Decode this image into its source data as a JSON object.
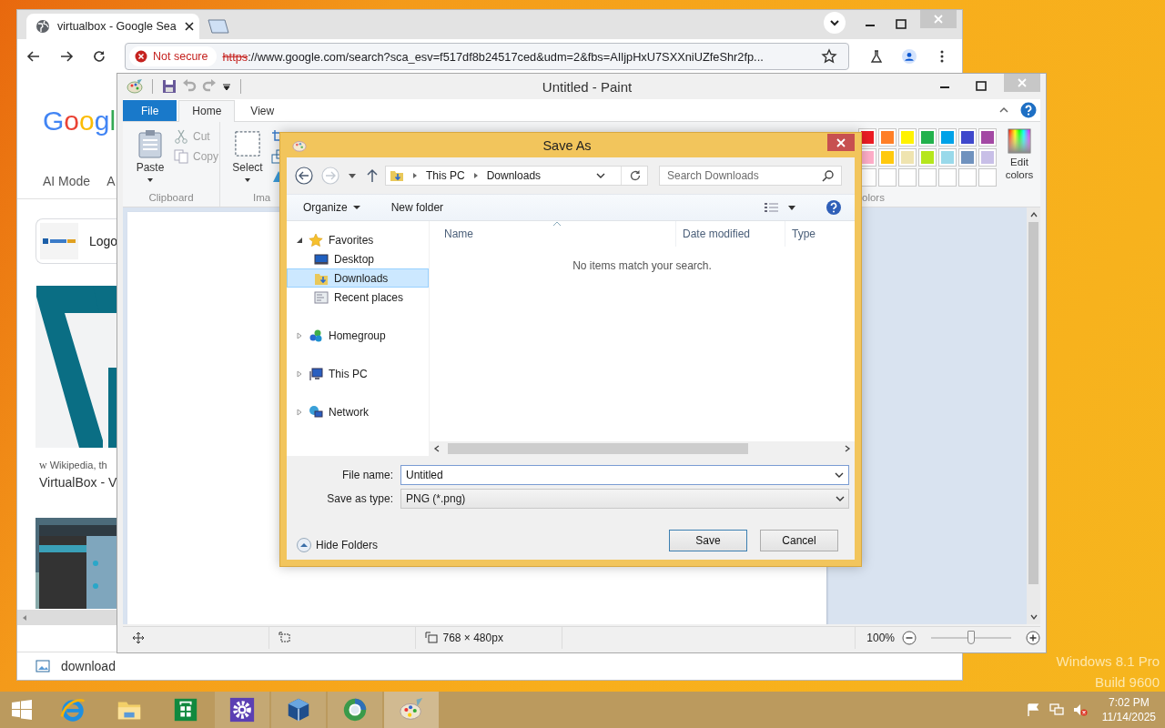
{
  "browser": {
    "tab": {
      "title": "virtualbox - Google Sea",
      "selected": true
    },
    "security": "Not secure",
    "url_scheme": "https",
    "url_rest": "://www.google.com/search?sca_esv=f517df8b24517ced&udm=2&fbs=AIljpHxU7SXXniUZfeShr2fp...",
    "logo": "Googl",
    "nav": [
      "AI Mode",
      "A"
    ],
    "card_label": "Logo",
    "source_mark": "w",
    "source": "Wikipedia, th",
    "result_title": "VirtualBox - V",
    "download": "download"
  },
  "paint": {
    "title": "Untitled - Paint",
    "tabs": [
      {
        "label": "File",
        "kind": "file",
        "selected": false
      },
      {
        "label": "Home",
        "kind": "tab",
        "selected": true
      },
      {
        "label": "View",
        "kind": "tab",
        "selected": false
      }
    ],
    "paste": "Paste",
    "cut": {
      "label": "Cut",
      "disabled": true
    },
    "copy": {
      "label": "Copy",
      "disabled": true
    },
    "clipboard_group": "Clipboard",
    "select": "Select",
    "image_group": "Ima",
    "palette": [
      {
        "color": "#ed1c24"
      },
      {
        "color": "#ff7f27"
      },
      {
        "color": "#fff200"
      },
      {
        "color": "#22b14c"
      },
      {
        "color": "#00a2e8"
      },
      {
        "color": "#3f48cc"
      },
      {
        "color": "#a349a4"
      },
      {
        "color": "#ffaec9"
      },
      {
        "color": "#ffc90e"
      },
      {
        "color": "#efe4b0"
      },
      {
        "color": "#b5e61d"
      },
      {
        "color": "#99d9ea"
      },
      {
        "color": "#7092be"
      },
      {
        "color": "#c8bfe7"
      }
    ],
    "edit_colors": "Edit colors",
    "colors_group": "olors",
    "status": {
      "size": "768 × 480px",
      "zoom": "100%",
      "zoom_slider": {
        "level": 0.5
      }
    }
  },
  "dialog": {
    "title": "Save As",
    "path": [
      "This PC",
      "Downloads"
    ],
    "search": {
      "placeholder": "Search Downloads"
    },
    "organize": "Organize",
    "new_folder": "New folder",
    "tree": [
      {
        "label": "Favorites",
        "kind": "favorites",
        "expanded": true,
        "selected": false,
        "children": [
          {
            "label": "Desktop",
            "kind": "desktop",
            "selected": false
          },
          {
            "label": "Downloads",
            "kind": "downloads",
            "selected": true
          },
          {
            "label": "Recent places",
            "kind": "recent",
            "selected": false
          }
        ]
      },
      {
        "label": "Homegroup",
        "kind": "homegroup",
        "expanded": false,
        "selected": false
      },
      {
        "label": "This PC",
        "kind": "pc",
        "expanded": false,
        "selected": false
      },
      {
        "label": "Network",
        "kind": "network",
        "expanded": false,
        "selected": false
      }
    ],
    "columns": [
      "Name",
      "Date modified",
      "Type"
    ],
    "empty_message": "No items match your search.",
    "file_name": {
      "label": "File name:",
      "value": "Untitled"
    },
    "file_type": {
      "label": "Save as type:",
      "value": "PNG (*.png)"
    },
    "hide_folders": "Hide Folders",
    "buttons": [
      {
        "label": "Save",
        "kind": "default"
      },
      {
        "label": "Cancel",
        "kind": "normal"
      }
    ]
  },
  "taskbar": {
    "apps": [
      {
        "kind": "ie",
        "running": false,
        "selected": false
      },
      {
        "kind": "explorer",
        "running": false,
        "selected": false
      },
      {
        "kind": "store",
        "running": false,
        "selected": false
      },
      {
        "kind": "settings",
        "running": true,
        "selected": false
      },
      {
        "kind": "virtualbox",
        "running": true,
        "selected": false
      },
      {
        "kind": "browser",
        "running": true,
        "selected": false
      },
      {
        "kind": "paint",
        "running": true,
        "selected": true
      }
    ],
    "time": "7:02 PM",
    "date": "11/14/2025"
  },
  "watermark": [
    "Windows 8.1 Pro",
    "Build 9600"
  ]
}
